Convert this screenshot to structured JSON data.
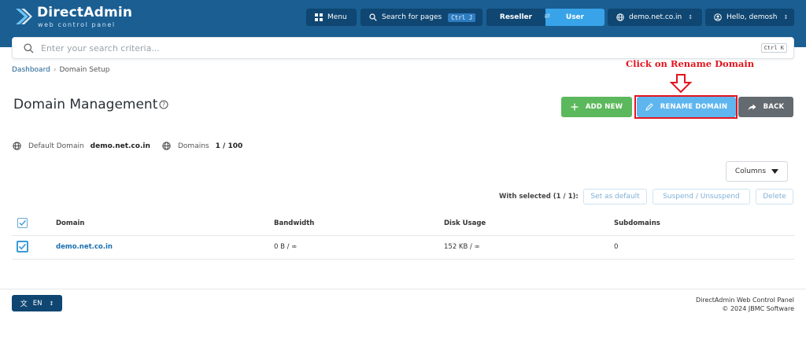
{
  "header": {
    "brand": "DirectAdmin",
    "brand_sub": "web control panel",
    "menu_label": "Menu",
    "search_pages_label": "Search for pages",
    "search_pages_shortcut": "Ctrl J",
    "role_reseller": "Reseller",
    "role_user": "User",
    "domain_selector": "demo.net.co.in",
    "user_greeting": "Hello, demosh"
  },
  "search": {
    "placeholder": "Enter your search criteria...",
    "shortcut": "Ctrl K"
  },
  "breadcrumb": {
    "home": "Dashboard",
    "current": "Domain Setup"
  },
  "annotation": {
    "text": "Click on Rename Domain",
    "color": "#e4141f"
  },
  "page": {
    "title": "Domain Management"
  },
  "actions": {
    "add_new": "ADD NEW",
    "rename_domain": "RENAME DOMAIN",
    "back": "BACK"
  },
  "stats": {
    "default_domain_label": "Default Domain",
    "default_domain_value": "demo.net.co.in",
    "domains_label": "Domains",
    "domains_value": "1 / 100"
  },
  "table_controls": {
    "columns_label": "Columns",
    "with_selected": "With selected (1 / 1):",
    "set_default": "Set as default",
    "suspend": "Suspend / Unsuspend",
    "delete": "Delete"
  },
  "table": {
    "headers": [
      "Domain",
      "Bandwidth",
      "Disk Usage",
      "Subdomains"
    ],
    "rows": [
      {
        "domain": "demo.net.co.in",
        "bandwidth": "0 B / ∞",
        "disk": "152 KB / ∞",
        "subdomains": "0",
        "checked": true
      }
    ]
  },
  "footer": {
    "lang": "EN",
    "line1": "DirectAdmin Web Control Panel",
    "line2": "© 2024 JBMC Software"
  },
  "colors": {
    "header_bg": "#1a5e92",
    "accent": "#38a3e8",
    "add_green": "#5cb85c",
    "rename_blue": "#5fb6ee",
    "back_gray": "#636a70"
  }
}
